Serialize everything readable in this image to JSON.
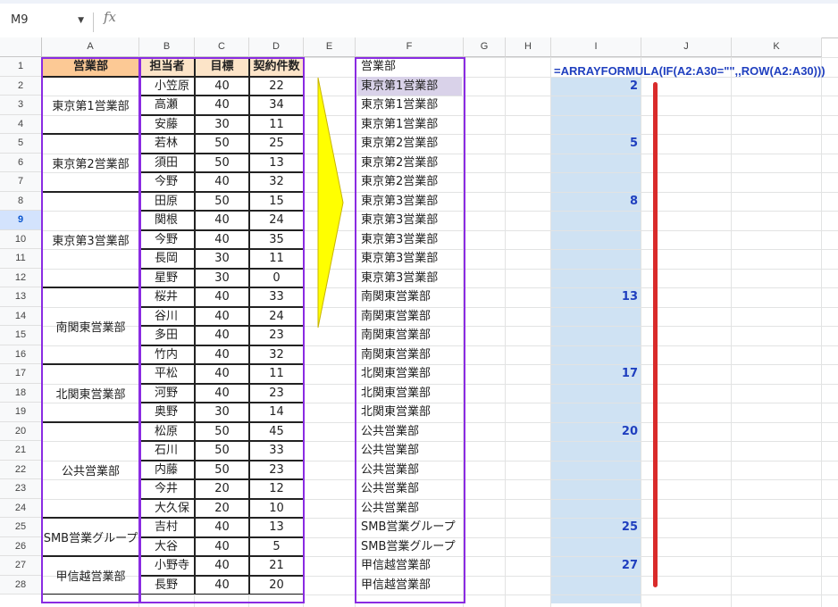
{
  "name_box": "M9",
  "fx_label": "fx",
  "columns": [
    "A",
    "B",
    "C",
    "D",
    "E",
    "F",
    "G",
    "H",
    "I",
    "J",
    "K"
  ],
  "rows": [
    "1",
    "2",
    "3",
    "4",
    "5",
    "6",
    "7",
    "8",
    "9",
    "10",
    "11",
    "12",
    "13",
    "14",
    "15",
    "16",
    "17",
    "18",
    "19",
    "20",
    "21",
    "22",
    "23",
    "24",
    "25",
    "26",
    "27",
    "28"
  ],
  "selected_row": "9",
  "headers": {
    "dept": "営業部",
    "person": "担当者",
    "target": "目標",
    "contracts": "契約件数"
  },
  "groups": [
    {
      "dept": "東京第1営業部",
      "members": [
        [
          "小笠原",
          "40",
          "22"
        ],
        [
          "高瀬",
          "40",
          "34"
        ],
        [
          "安藤",
          "30",
          "11"
        ]
      ]
    },
    {
      "dept": "東京第2営業部",
      "members": [
        [
          "若林",
          "50",
          "25"
        ],
        [
          "須田",
          "50",
          "13"
        ],
        [
          "今野",
          "40",
          "32"
        ]
      ]
    },
    {
      "dept": "東京第3営業部",
      "members": [
        [
          "田原",
          "50",
          "15"
        ],
        [
          "関根",
          "40",
          "24"
        ],
        [
          "今野",
          "40",
          "35"
        ],
        [
          "長岡",
          "30",
          "11"
        ],
        [
          "星野",
          "30",
          "0"
        ]
      ]
    },
    {
      "dept": "南関東営業部",
      "members": [
        [
          "桜井",
          "40",
          "33"
        ],
        [
          "谷川",
          "40",
          "24"
        ],
        [
          "多田",
          "40",
          "23"
        ],
        [
          "竹内",
          "40",
          "32"
        ]
      ]
    },
    {
      "dept": "北関東営業部",
      "members": [
        [
          "平松",
          "40",
          "11"
        ],
        [
          "河野",
          "40",
          "23"
        ],
        [
          "奥野",
          "30",
          "14"
        ]
      ]
    },
    {
      "dept": "公共営業部",
      "members": [
        [
          "松原",
          "50",
          "45"
        ],
        [
          "石川",
          "50",
          "33"
        ],
        [
          "内藤",
          "50",
          "23"
        ],
        [
          "今井",
          "20",
          "12"
        ],
        [
          "大久保",
          "20",
          "10"
        ]
      ]
    },
    {
      "dept": "SMB営業グループ",
      "members": [
        [
          "吉村",
          "40",
          "13"
        ],
        [
          "大谷",
          "40",
          "5"
        ]
      ]
    },
    {
      "dept": "甲信越営業部",
      "members": [
        [
          "小野寺",
          "40",
          "21"
        ],
        [
          "長野",
          "40",
          "20"
        ]
      ]
    }
  ],
  "colF": [
    "営業部",
    "東京第1営業部",
    "東京第1営業部",
    "東京第1営業部",
    "東京第2営業部",
    "東京第2営業部",
    "東京第2営業部",
    "東京第3営業部",
    "東京第3営業部",
    "東京第3営業部",
    "東京第3営業部",
    "東京第3営業部",
    "南関東営業部",
    "南関東営業部",
    "南関東営業部",
    "南関東営業部",
    "北関東営業部",
    "北関東営業部",
    "北関東営業部",
    "公共営業部",
    "公共営業部",
    "公共営業部",
    "公共営業部",
    "公共営業部",
    "SMB営業グループ",
    "SMB営業グループ",
    "甲信越営業部",
    "甲信越営業部"
  ],
  "colI": [
    "",
    "2",
    "",
    "",
    "5",
    "",
    "",
    "8",
    "",
    "",
    "",
    "",
    "13",
    "",
    "",
    "",
    "17",
    "",
    "",
    "20",
    "",
    "",
    "",
    "",
    "25",
    "",
    "27",
    ""
  ],
  "formula": "=ARRAYFORMULA(IF(A2:A30=\"\",,ROW(A2:A30)))",
  "colors": {
    "header_orange": "#fcc995",
    "header_light": "#fce4c8",
    "purple_border": "#8a2be2",
    "selection_blue": "#cfe2f3",
    "red_bar": "#d92b2b",
    "arrow_yellow": "#ffff00"
  }
}
